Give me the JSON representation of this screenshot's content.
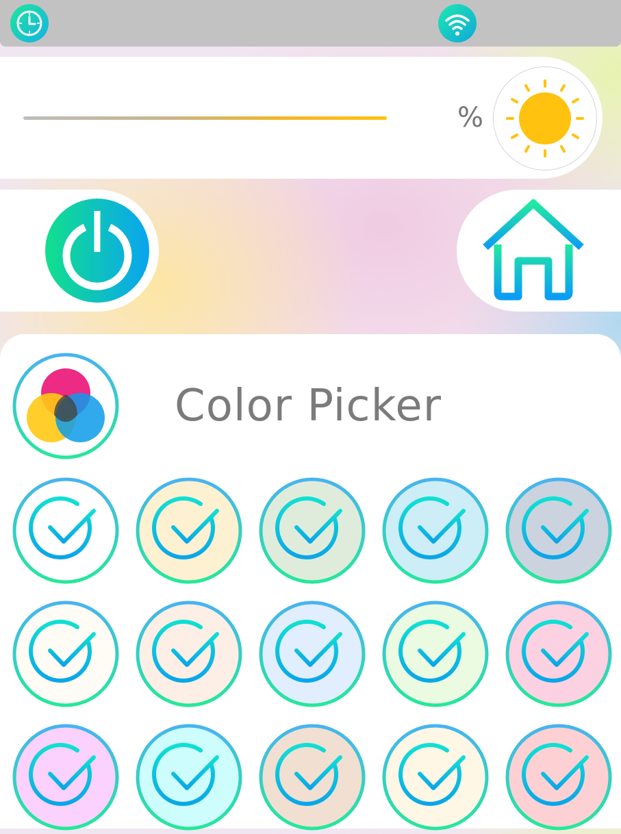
{
  "status_bar": {
    "left_icon": "clock-icon",
    "right_icon": "wifi-icon"
  },
  "brightness": {
    "unit_label": "%",
    "icon": "sun-icon",
    "accent_color": "#ffc20e"
  },
  "controls": {
    "power_icon": "power-icon",
    "home_icon": "home-icon"
  },
  "color_picker": {
    "title": "Color Picker",
    "icon": "color-wheel-icon",
    "swatch_icon": "check-circle-icon",
    "swatches": [
      "#ffffff",
      "#fdf1d2",
      "#e0ecdb",
      "#cdedf7",
      "#cbd3df",
      "#fffcf5",
      "#fdefe6",
      "#e1eefd",
      "#eafbe2",
      "#fcd1e1",
      "#fbd1fd",
      "#cdfdfd",
      "#f1dfd1",
      "#fef7e6",
      "#fdd1d3"
    ]
  },
  "colors": {
    "gradient_start": "#12e08c",
    "gradient_end": "#0aa4f0",
    "status_bar_bg": "#c3c2c3"
  }
}
